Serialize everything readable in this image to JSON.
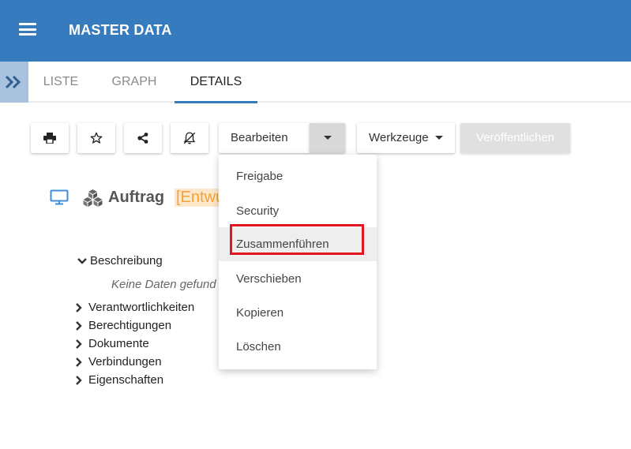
{
  "app": {
    "title": "MASTER DATA"
  },
  "tabs": [
    {
      "label": "LISTE",
      "active": false
    },
    {
      "label": "GRAPH",
      "active": false
    },
    {
      "label": "DETAILS",
      "active": true
    }
  ],
  "toolbar": {
    "print_icon": "printer-icon",
    "favorite_icon": "star-icon",
    "share_icon": "share-icon",
    "notify_icon": "bell-slash-icon",
    "edit_label": "Bearbeiten",
    "tools_label": "Werkzeuge",
    "publish_label": "Veröffentlichen"
  },
  "object": {
    "type_icon": "monitor-icon",
    "category_icon": "cubes-icon",
    "title": "Auftrag",
    "status": "[Entwu"
  },
  "tree": {
    "expanded_item": "Beschreibung",
    "empty_text": "Keine Daten gefund",
    "items": [
      "Verantwortlichkeiten",
      "Berechtigungen",
      "Dokumente",
      "Verbindungen",
      "Eigenschaften"
    ]
  },
  "dropdown": {
    "items": [
      "Freigabe",
      "Security",
      "Zusammenführen",
      "Verschieben",
      "Kopieren",
      "Löschen"
    ],
    "hovered": "Zusammenführen"
  },
  "colors": {
    "appbar": "#357bbd",
    "tab_indicator": "#357bbd",
    "status_text": "#f2a33a",
    "highlight": "#e4141e"
  }
}
